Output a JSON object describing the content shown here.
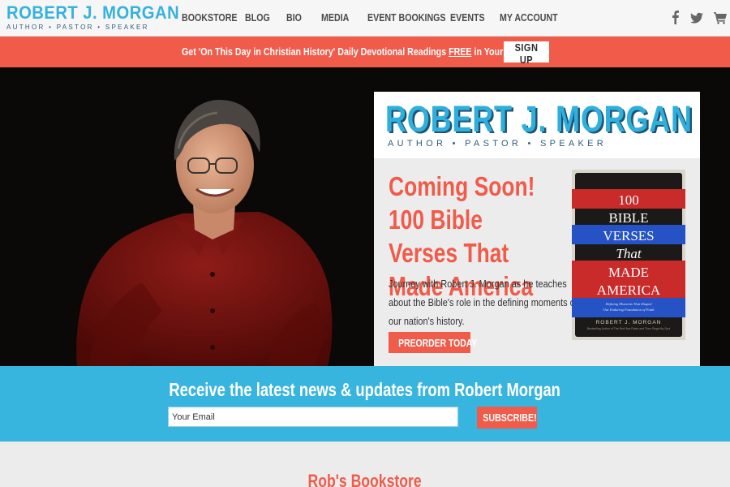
{
  "header": {
    "logo_name": "ROBERT J. MORGAN",
    "logo_tagline": "AUTHOR • PASTOR • SPEAKER",
    "nav": [
      {
        "label": "BOOKSTORE"
      },
      {
        "label": "BLOG"
      },
      {
        "label": "BIO"
      },
      {
        "label": "MEDIA"
      },
      {
        "label": "EVENT BOOKINGS"
      },
      {
        "label": "EVENTS"
      },
      {
        "label": "MY ACCOUNT"
      }
    ],
    "social_icons": [
      "facebook-icon",
      "twitter-icon",
      "cart-icon"
    ]
  },
  "promo": {
    "text_before": "Get 'On This Day in Christian History' Daily Devotional Readings ",
    "text_free": "FREE",
    "text_after": " in Your Inbox",
    "button_label": "SIGN UP"
  },
  "hero": {
    "card_name": "ROBERT J. MORGAN",
    "card_tagline": "AUTHOR • PASTOR • SPEAKER",
    "headline": "Coming Soon! 100 Bible Verses That Made America",
    "description": "Journey with Robert J. Morgan as he teaches about the Bible's role in the defining moments of our nation's history.",
    "button_label": "PREORDER TODAY",
    "book_cover": {
      "line1": "100",
      "line2": "BIBLE",
      "line3": "VERSES",
      "line4": "That",
      "line5": "MADE",
      "line6": "AMERICA",
      "subtitle1": "Defining Moments That Shaped",
      "subtitle2": "Our Enduring Foundation of Faith",
      "author": "ROBERT J. MORGAN",
      "author_sub": "Bestselling Author of The Red Sea Rules and Then Sings My Soul"
    }
  },
  "newsletter": {
    "title": "Receive the latest news & updates from Robert Morgan",
    "email_placeholder": "Your Email",
    "button_label": "SUBSCRIBE!"
  },
  "bookstore": {
    "title": "Rob's Bookstore"
  },
  "colors": {
    "accent_blue": "#38b5de",
    "accent_red": "#f05b4a",
    "navy": "#2f5d7c",
    "hero_bg": "#0a0908"
  }
}
